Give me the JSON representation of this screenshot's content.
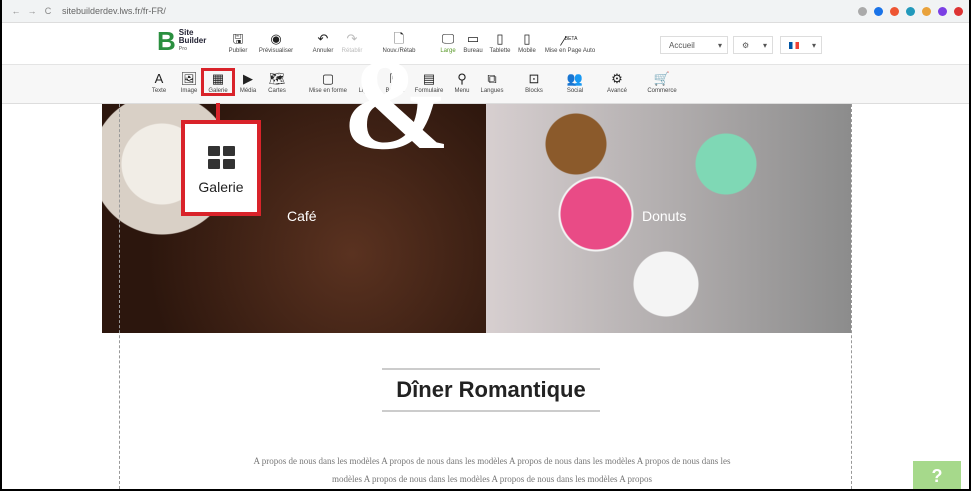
{
  "browser": {
    "url": "sitebuilderdev.lws.fr/fr-FR/"
  },
  "logo": {
    "line1": "Site",
    "line2": "Builder",
    "line3": "Pro"
  },
  "toolbar_top": [
    {
      "label": "Publier",
      "icon": "save-icon"
    },
    {
      "label": "Prévisualiser",
      "icon": "eye-icon"
    },
    {
      "label": "Annuler",
      "icon": "undo-icon"
    },
    {
      "label": "Rétablir",
      "icon": "redo-icon"
    },
    {
      "label": "Nouv./Rétab",
      "icon": "file-icon"
    },
    {
      "label": "Large",
      "icon": "desktop-icon"
    },
    {
      "label": "Bureau",
      "icon": "laptop-icon"
    },
    {
      "label": "Tablette",
      "icon": "tablet-icon"
    },
    {
      "label": "Mobile",
      "icon": "mobile-icon"
    },
    {
      "label": "Mise en Page Auto",
      "icon": "magic-wand-icon",
      "badge": "BETA"
    }
  ],
  "page_select": "Accueil",
  "toolbar_elements": [
    {
      "label": "Texte"
    },
    {
      "label": "Image"
    },
    {
      "label": "Galerie"
    },
    {
      "label": "Média"
    },
    {
      "label": "Cartes"
    },
    {
      "label": "Mise en forme"
    },
    {
      "label": "Ligne"
    },
    {
      "label": "Bouton"
    },
    {
      "label": "Formulaire"
    },
    {
      "label": "Menu"
    },
    {
      "label": "Langues"
    },
    {
      "label": "Blocks"
    },
    {
      "label": "Social"
    },
    {
      "label": "Avancé"
    },
    {
      "label": "Commerce"
    }
  ],
  "callout": {
    "label": "Galerie"
  },
  "hero": {
    "left": "Café",
    "amp": "&",
    "right": "Donuts"
  },
  "content": {
    "title": "Dîner Romantique",
    "paragraph": "A propos de nous dans les modèles A propos de nous dans les modèles A propos de nous dans les modèles A propos de nous dans les modèles A propos de nous dans les modèles A propos de nous dans les modèles A propos"
  },
  "help": "?",
  "colors": {
    "accent": "#d9232a",
    "help": "#a6d98b"
  }
}
